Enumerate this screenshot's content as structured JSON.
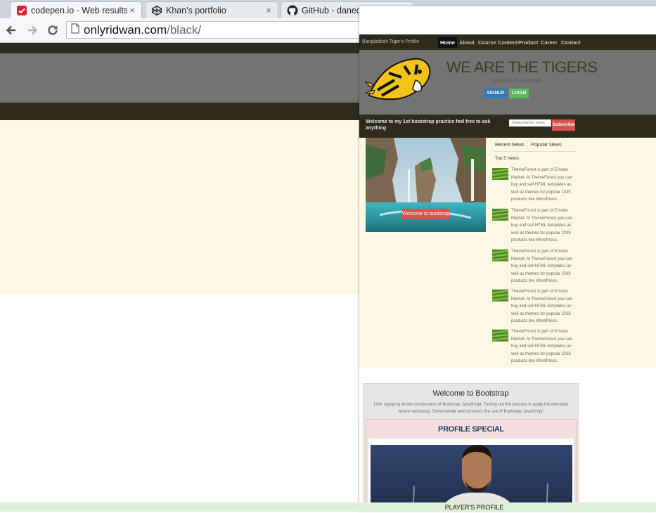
{
  "browser": {
    "tabs": [
      {
        "title": "codepen.io - Web results",
        "icon": "codepen-search-icon",
        "close": "×"
      },
      {
        "title": "Khan's portfolio",
        "icon": "codepen-icon",
        "close": "×"
      },
      {
        "title": "GitHub - danede",
        "icon": "github-icon",
        "close": ""
      }
    ],
    "url_host": "onlyridwan.com",
    "url_path": "/black/"
  },
  "popup": {
    "brand": "Bangladesh Tiger's Profile",
    "nav": [
      "Home",
      "About",
      "Course Content",
      "Product",
      "Career",
      "Contact"
    ],
    "hero_title": "WE ARE THE TIGERS",
    "hero_tagline": "NGAN IS OUR WORD",
    "signup": "SIGNUP",
    "login": "LOGIN",
    "welcome": "Welcome to my 1st bootstrap practice feel free to ask anything",
    "newsletter_placeholder": "Subscribe for news",
    "subscribe": "Subscribe",
    "carousel_caption": "Welcome to bootstrap",
    "tabs": [
      "Recent News",
      "Popular News"
    ],
    "top_news_heading": "Top 5 News",
    "news": [
      "ThemeForest is part of Envato Market. At ThemeForest you can buy and sell HTML templates as well as themes for popular CMS products like WordPress.",
      "ThemeForest is part of Envato Market. At ThemeForest you can buy and sell HTML templates as well as themes for popular CMS products like WordPress.",
      "ThemeForest is part of Envato Market. At ThemeForest you can buy and sell HTML templates as well as themes for popular CMS products like WordPress.",
      "ThemeForest is part of Envato Market. At ThemeForest you can buy and sell HTML templates as well as themes for popular CMS products like WordPress.",
      "ThemeForest is part of Envato Market. At ThemeForest you can buy and sell HTML templates as well as themes for popular CMS products like WordPress."
    ],
    "card_title": "Welcome to Bootstrap",
    "card_desc": "LO4: Applying all the components of Bootstrap JavaScript. Testing out the process to apply the elements where necessary. Demonstrate and construct the use of Bootstrap JavaScript.",
    "profile_heading": "PROFILE SPECIAL"
  },
  "footer": "PLAYER'S PROFILE",
  "colors": {
    "dark_bar": "#2c2b1d",
    "hero_grey": "#737373",
    "cream": "#fdf8e3",
    "signup": "#337ab7",
    "login": "#5cb85c",
    "subscribe": "#d9534f",
    "footer": "#dff0d8"
  }
}
